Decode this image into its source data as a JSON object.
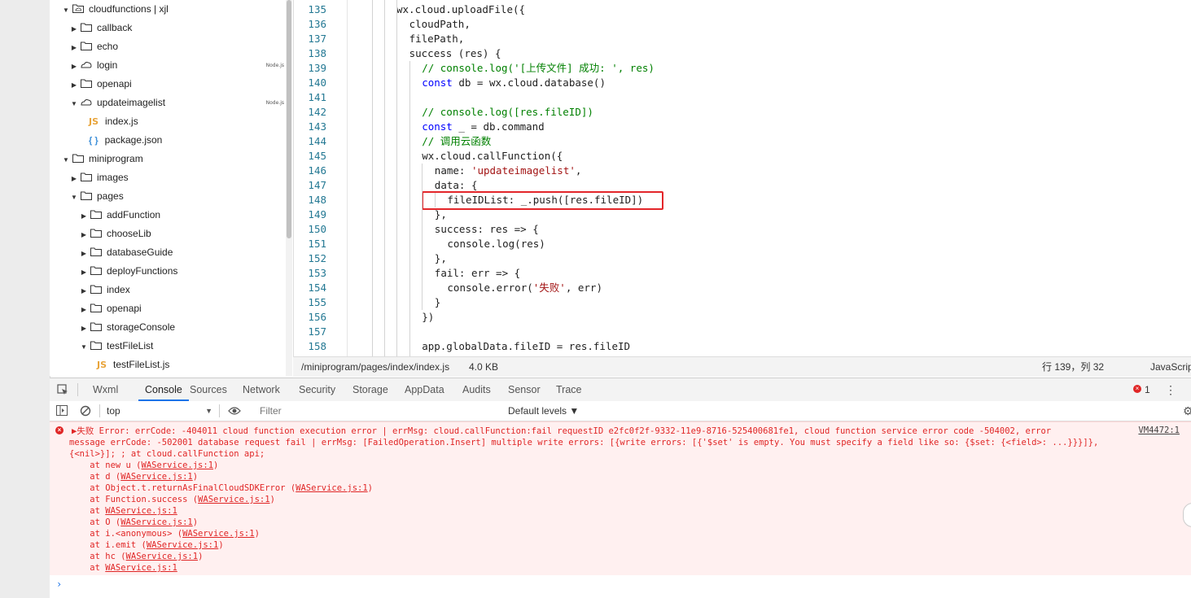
{
  "explorer": {
    "items": [
      {
        "label": "cloudfunctions | xjl",
        "type": "folder-cloud",
        "expanded": true,
        "depth": 0
      },
      {
        "label": "callback",
        "type": "folder",
        "expanded": false,
        "depth": 1
      },
      {
        "label": "echo",
        "type": "folder",
        "expanded": false,
        "depth": 1
      },
      {
        "label": "login",
        "type": "cloud",
        "expanded": false,
        "depth": 1,
        "badge": "Node.js"
      },
      {
        "label": "openapi",
        "type": "folder",
        "expanded": false,
        "depth": 1
      },
      {
        "label": "updateimagelist",
        "type": "cloud",
        "expanded": true,
        "depth": 1,
        "badge": "Node.js"
      },
      {
        "label": "index.js",
        "type": "js",
        "depth": 2
      },
      {
        "label": "package.json",
        "type": "json",
        "depth": 2
      },
      {
        "label": "miniprogram",
        "type": "folder",
        "expanded": true,
        "depth": 0
      },
      {
        "label": "images",
        "type": "folder",
        "expanded": false,
        "depth": 1
      },
      {
        "label": "pages",
        "type": "folder",
        "expanded": true,
        "depth": 1
      },
      {
        "label": "addFunction",
        "type": "folder",
        "expanded": false,
        "depth": 2
      },
      {
        "label": "chooseLib",
        "type": "folder",
        "expanded": false,
        "depth": 2
      },
      {
        "label": "databaseGuide",
        "type": "folder",
        "expanded": false,
        "depth": 2
      },
      {
        "label": "deployFunctions",
        "type": "folder",
        "expanded": false,
        "depth": 2
      },
      {
        "label": "index",
        "type": "folder",
        "expanded": false,
        "depth": 2
      },
      {
        "label": "openapi",
        "type": "folder",
        "expanded": false,
        "depth": 2
      },
      {
        "label": "storageConsole",
        "type": "folder",
        "expanded": false,
        "depth": 2
      },
      {
        "label": "testFileList",
        "type": "folder",
        "expanded": true,
        "depth": 2
      },
      {
        "label": "testFileList.js",
        "type": "js",
        "depth": 3
      }
    ]
  },
  "editor": {
    "lines": [
      {
        "n": "135",
        "indent": 0,
        "tokens": [
          {
            "t": "wx.cloud.uploadFile({",
            "c": ""
          }
        ]
      },
      {
        "n": "136",
        "indent": 1,
        "tokens": [
          {
            "t": "cloudPath,",
            "c": ""
          }
        ]
      },
      {
        "n": "137",
        "indent": 1,
        "tokens": [
          {
            "t": "filePath,",
            "c": ""
          }
        ]
      },
      {
        "n": "138",
        "indent": 1,
        "tokens": [
          {
            "t": "success (res) {",
            "c": ""
          }
        ]
      },
      {
        "n": "139",
        "indent": 2,
        "tokens": [
          {
            "t": "// console.log('[上传文件] 成功: ', res)",
            "c": "cm"
          }
        ]
      },
      {
        "n": "140",
        "indent": 2,
        "tokens": [
          {
            "t": "const",
            "c": "kw"
          },
          {
            "t": " db = wx.cloud.database()",
            "c": ""
          }
        ]
      },
      {
        "n": "141",
        "indent": 2,
        "tokens": []
      },
      {
        "n": "142",
        "indent": 2,
        "tokens": [
          {
            "t": "// console.log([res.fileID])",
            "c": "cm"
          }
        ]
      },
      {
        "n": "143",
        "indent": 2,
        "tokens": [
          {
            "t": "const",
            "c": "kw"
          },
          {
            "t": " _ = db.command",
            "c": ""
          }
        ]
      },
      {
        "n": "144",
        "indent": 2,
        "tokens": [
          {
            "t": "// 调用云函数",
            "c": "cm"
          }
        ]
      },
      {
        "n": "145",
        "indent": 2,
        "tokens": [
          {
            "t": "wx.cloud.callFunction({",
            "c": ""
          }
        ]
      },
      {
        "n": "146",
        "indent": 3,
        "tokens": [
          {
            "t": "name: ",
            "c": ""
          },
          {
            "t": "'updateimagelist'",
            "c": "str"
          },
          {
            "t": ",",
            "c": ""
          }
        ]
      },
      {
        "n": "147",
        "indent": 3,
        "tokens": [
          {
            "t": "data: {",
            "c": ""
          }
        ]
      },
      {
        "n": "148",
        "indent": 4,
        "tokens": [
          {
            "t": "fileIDList: _.push([res.fileID])",
            "c": ""
          }
        ]
      },
      {
        "n": "149",
        "indent": 3,
        "tokens": [
          {
            "t": "},",
            "c": ""
          }
        ]
      },
      {
        "n": "150",
        "indent": 3,
        "tokens": [
          {
            "t": "success: res => {",
            "c": ""
          }
        ]
      },
      {
        "n": "151",
        "indent": 4,
        "tokens": [
          {
            "t": "console.log(res)",
            "c": ""
          }
        ]
      },
      {
        "n": "152",
        "indent": 3,
        "tokens": [
          {
            "t": "},",
            "c": ""
          }
        ]
      },
      {
        "n": "153",
        "indent": 3,
        "tokens": [
          {
            "t": "fail: err => {",
            "c": ""
          }
        ]
      },
      {
        "n": "154",
        "indent": 4,
        "tokens": [
          {
            "t": "console.error(",
            "c": ""
          },
          {
            "t": "'失败'",
            "c": "str"
          },
          {
            "t": ", err)",
            "c": ""
          }
        ]
      },
      {
        "n": "155",
        "indent": 3,
        "tokens": [
          {
            "t": "}",
            "c": ""
          }
        ]
      },
      {
        "n": "156",
        "indent": 2,
        "tokens": [
          {
            "t": "})",
            "c": ""
          }
        ]
      },
      {
        "n": "157",
        "indent": 2,
        "tokens": []
      },
      {
        "n": "158",
        "indent": 2,
        "tokens": [
          {
            "t": "app.globalData.fileID = res.fileID",
            "c": ""
          }
        ]
      }
    ]
  },
  "statusbar": {
    "path": "/miniprogram/pages/index/index.js",
    "size": "4.0 KB",
    "cursor": "行 139，列 32",
    "language": "JavaScript"
  },
  "devtools": {
    "tabs": [
      "Wxml",
      "Console",
      "Sources",
      "Network",
      "Security",
      "Storage",
      "AppData",
      "Audits",
      "Sensor",
      "Trace"
    ],
    "active_tab": "Console",
    "error_count": "1",
    "context": "top",
    "filter_placeholder": "Filter",
    "levels": "Default levels ▼"
  },
  "console": {
    "error_source": "VM4472:1",
    "error_lines": [
      "▶失败 Error: errCode: -404011 cloud function execution error | errMsg: cloud.callFunction:fail requestID e2fc0f2f-9332-11e9-8716-525400681fe1, cloud function service error code -504002, error",
      "message errCode: -502001 database request fail | errMsg: [FailedOperation.Insert] multiple write errors: [{write errors: [{'$set' is empty. You must specify a field like so: {$set: {<field>: ...}}}]},",
      "{<nil>}]; ; at cloud.callFunction api;"
    ],
    "stack": [
      {
        "prefix": "    at new u (",
        "link": "WAService.js:1",
        "suffix": ")"
      },
      {
        "prefix": "    at d (",
        "link": "WAService.js:1",
        "suffix": ")"
      },
      {
        "prefix": "    at Object.t.returnAsFinalCloudSDKError (",
        "link": "WAService.js:1",
        "suffix": ")"
      },
      {
        "prefix": "    at Function.success (",
        "link": "WAService.js:1",
        "suffix": ")"
      },
      {
        "prefix": "    at ",
        "link": "WAService.js:1",
        "suffix": ""
      },
      {
        "prefix": "    at O (",
        "link": "WAService.js:1",
        "suffix": ")"
      },
      {
        "prefix": "    at i.<anonymous> (",
        "link": "WAService.js:1",
        "suffix": ")"
      },
      {
        "prefix": "    at i.emit (",
        "link": "WAService.js:1",
        "suffix": ")"
      },
      {
        "prefix": "    at hc (",
        "link": "WAService.js:1",
        "suffix": ")"
      },
      {
        "prefix": "    at ",
        "link": "WAService.js:1",
        "suffix": ""
      }
    ],
    "prompt": "›"
  },
  "colors": {
    "accent": "#1a73e8",
    "error": "#e02626",
    "error_bg": "#fff0f0",
    "highlight_box": "#e3262a"
  }
}
